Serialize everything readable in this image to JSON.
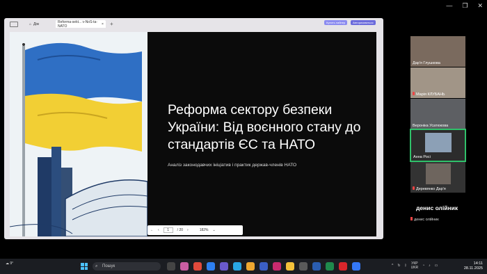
{
  "browser": {
    "home_label": "Дім",
    "tab_label": "Reforma-sekt... v-NoS-ta-NATO",
    "tab_close": "×",
    "new_tab": "+",
    "buy_label": "Купить лайнер",
    "login_label": "Авторизоваться"
  },
  "slide": {
    "title": "Реформа сектору безпеки України: Від воєнного стану до стандартів ЄС та НАТО",
    "subtitle": "Аналіз законодавчих ініціатив і практик держав-членів НАТО"
  },
  "pager": {
    "current_page": "1",
    "total_pages": "/ 20",
    "zoom": "182%"
  },
  "participants": [
    {
      "name": "Дар'я Глушкова",
      "muted": false
    },
    {
      "name": "Марія КЛУБАНЬ",
      "muted": true
    },
    {
      "name": "Вероніка Усатюкова",
      "muted": false
    },
    {
      "name": "Анна Росі",
      "muted": false,
      "speaking": true
    },
    {
      "name": "Деревянко Дар'я",
      "muted": true
    }
  ],
  "featured": {
    "big_name": "денис олійник",
    "small_name": "денис олійник"
  },
  "taskbar": {
    "weather": "9°",
    "search_placeholder": "Пошук",
    "lang": "УКР",
    "lang2": "UKR",
    "time": "14:11",
    "date": "28.11.2025"
  },
  "colors": {
    "ukraine_blue": "#2f6fc4",
    "ukraine_yellow": "#f2cf34",
    "speaker_border": "#2fc16a"
  }
}
